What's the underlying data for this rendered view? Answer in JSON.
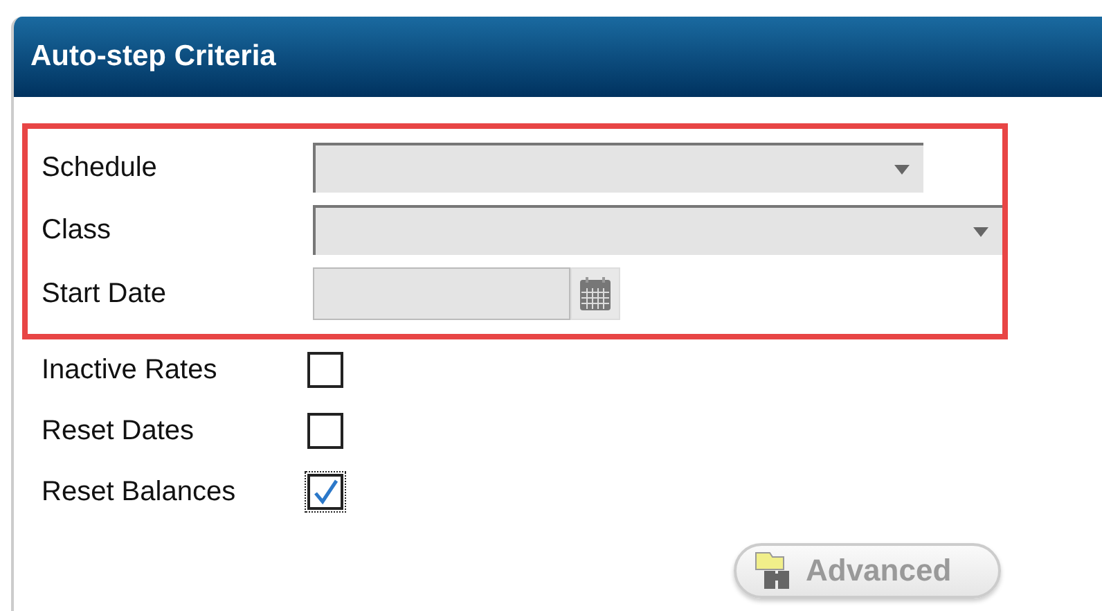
{
  "panel": {
    "title": "Auto-step Criteria"
  },
  "highlighted_fields": [
    {
      "label": "Schedule",
      "kind": "select"
    },
    {
      "label": "Class",
      "kind": "select"
    },
    {
      "label": "Start Date",
      "kind": "date"
    }
  ],
  "checkboxes": [
    {
      "label": "Inactive Rates",
      "checked": false,
      "focused": false
    },
    {
      "label": "Reset Dates",
      "checked": false,
      "focused": false
    },
    {
      "label": "Reset Balances",
      "checked": true,
      "focused": true
    }
  ],
  "advanced_button": {
    "label": "Advanced",
    "disabled": true
  }
}
